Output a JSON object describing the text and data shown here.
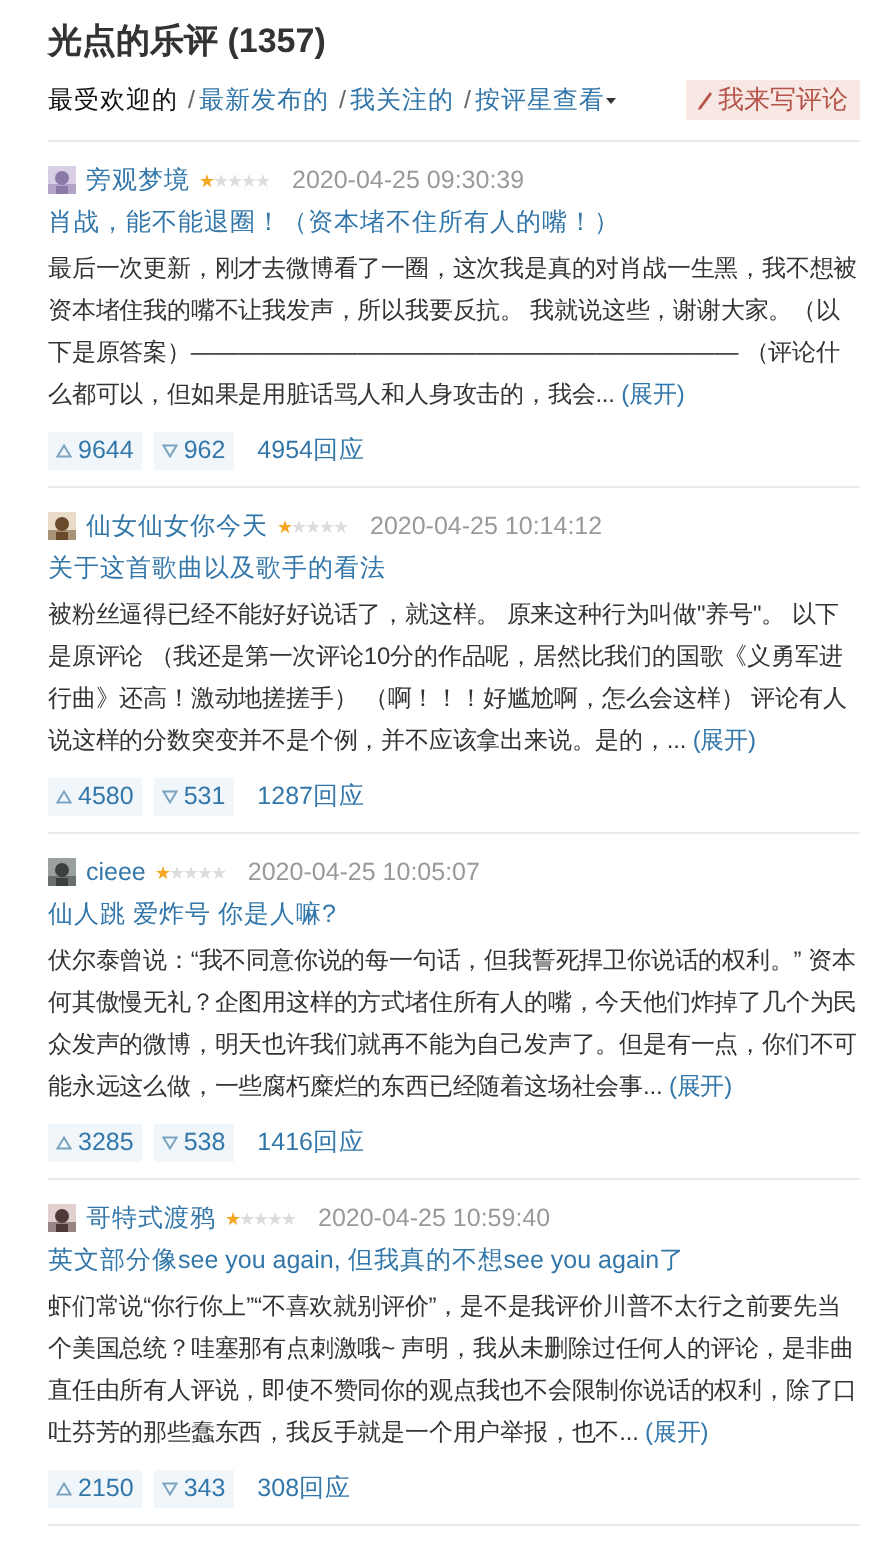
{
  "title": "光点的乐评 (1357)",
  "filters": [
    {
      "label": "最受欢迎的",
      "selected": true,
      "dropdown": false
    },
    {
      "label": "最新发布的",
      "separator": "/",
      "selected": false,
      "dropdown": false
    },
    {
      "label": "我关注的",
      "separator": "/",
      "selected": false,
      "dropdown": false
    },
    {
      "label": "按评星查看",
      "separator": "/",
      "selected": false,
      "dropdown": true
    }
  ],
  "write_button": "我来写评论",
  "reviews": [
    {
      "author": "旁观梦境",
      "stars": 1,
      "time": "2020-04-25 09:30:39",
      "title": "肖战，能不能退圈！（资本堵不住所有人的嘴！）",
      "body": "最后一次更新，刚才去微博看了一圈，这次我是真的对肖战一生黑，我不想被资本堵住我的嘴不让我发声，所以我要反抗。 我就说这些，谢谢大家。（以下是原答案）——————————————————————— （评论什么都可以，但如果是用脏话骂人和人身攻击的，我会...",
      "expand": "(展开)",
      "up": "9644",
      "down": "962",
      "replies": "4954回应"
    },
    {
      "author": "仙女仙女你今天",
      "stars": 1,
      "time": "2020-04-25 10:14:12",
      "title": "关于这首歌曲以及歌手的看法",
      "body": "被粉丝逼得已经不能好好说话了，就这样。 原来这种行为叫做\"养号\"。 以下是原评论 （我还是第一次评论10分的作品呢，居然比我们的国歌《义勇军进行曲》还高！激动地搓搓手） （啊！！！好尴尬啊，怎么会这样） 评论有人说这样的分数突变并不是个例，并不应该拿出来说。是的，...",
      "expand": "(展开)",
      "up": "4580",
      "down": "531",
      "replies": "1287回应"
    },
    {
      "author": "cieee",
      "stars": 1,
      "time": "2020-04-25 10:05:07",
      "title": "仙人跳 爱炸号 你是人嘛?",
      "body": "伏尔泰曾说：“我不同意你说的每一句话，但我誓死捍卫你说话的权利。” 资本何其傲慢无礼？企图用这样的方式堵住所有人的嘴，今天他们炸掉了几个为民众发声的微博，明天也许我们就再不能为自己发声了。但是有一点，你们不可能永远这么做，一些腐朽糜烂的东西已经随着这场社会事...",
      "expand": "(展开)",
      "up": "3285",
      "down": "538",
      "replies": "1416回应"
    },
    {
      "author": "哥特式渡鸦",
      "stars": 1,
      "time": "2020-04-25 10:59:40",
      "title": "英文部分像see you again, 但我真的不想see you again了",
      "body": "虾们常说“你行你上”“不喜欢就别评价”，是不是我评价川普不太行之前要先当个美国总统？哇塞那有点刺激哦~ 声明，我从未删除过任何人的评论，是非曲直任由所有人评说，即使不赞同你的观点我也不会限制你说话的权利，除了口吐芬芳的那些蠢东西，我反手就是一个用户举报，也不...",
      "expand": "(展开)",
      "up": "2150",
      "down": "343",
      "replies": "308回应"
    }
  ]
}
